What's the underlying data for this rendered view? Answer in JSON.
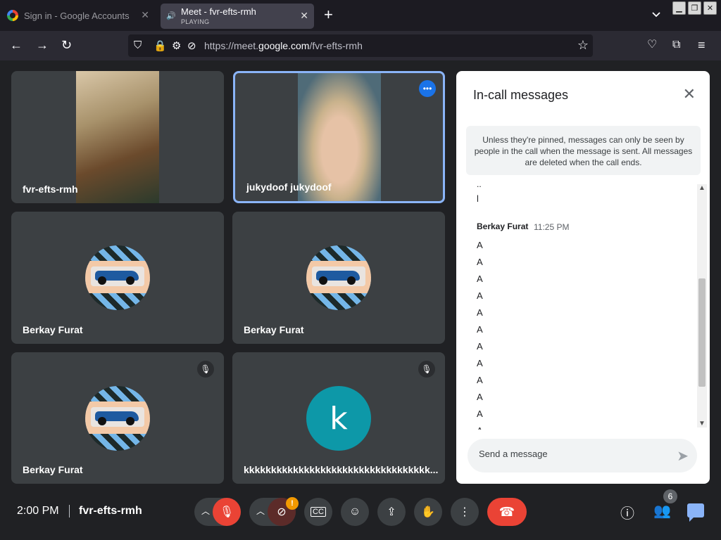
{
  "browser": {
    "tabs": [
      {
        "title": "Sign in - Google Accounts"
      },
      {
        "title": "Meet - fvr-efts-rmh",
        "subtitle": "PLAYING"
      }
    ],
    "url_prefix": "https://meet.",
    "url_domain": "google.com",
    "url_path": "/fvr-efts-rmh"
  },
  "tiles": [
    {
      "name": "fvr-efts-rmh"
    },
    {
      "name": "jukydoof jukydoof"
    },
    {
      "name": "Berkay Furat"
    },
    {
      "name": "Berkay Furat"
    },
    {
      "name": "Berkay Furat"
    },
    {
      "name": "kkkkkkkkkkkkkkkkkkkkkkkkkkkkkkkkkk...",
      "avatar_letter": "k"
    }
  ],
  "chat": {
    "title": "In-call messages",
    "notice": "Unless they're pinned, messages can only be seen by people in the call when the message is sent. All messages are deleted when the call ends.",
    "earlier": [
      "..",
      "l"
    ],
    "sender": "Berkay Furat",
    "time": "11:25 PM",
    "messages": [
      "A",
      "A",
      "A",
      "A",
      "A",
      "A",
      "A",
      "A",
      "A",
      "A",
      "A",
      "A"
    ],
    "input_placeholder": "Send a message"
  },
  "bottom": {
    "clock": "2:00 PM",
    "meeting_code": "fvr-efts-rmh",
    "people_count": "6",
    "camera_warning": "!"
  },
  "colors": {
    "accent": "#8ab4f8",
    "danger": "#ea4335",
    "warning": "#f29900"
  }
}
